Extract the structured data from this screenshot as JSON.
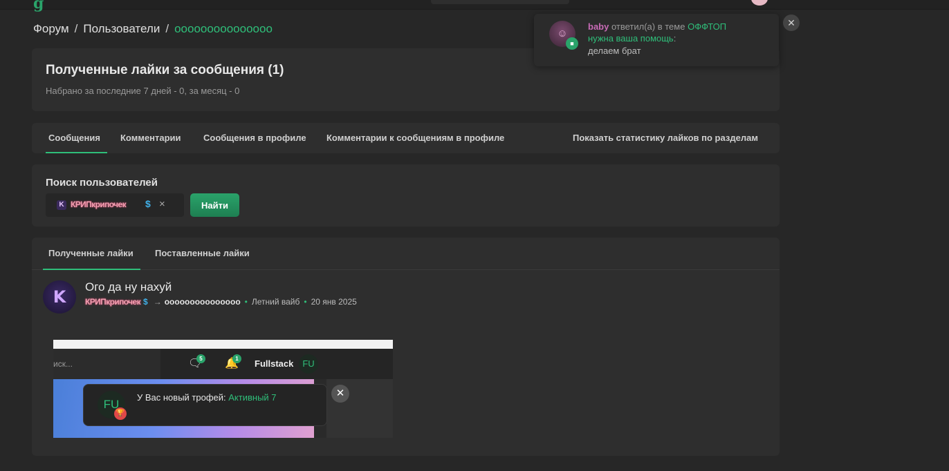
{
  "breadcrumb": {
    "item1": "Форум",
    "sep1": "/",
    "item2": "Пользователи",
    "sep2": "/",
    "current": "ооооооооооооооо"
  },
  "header": {
    "title": "Полученные лайки за сообщения (1)",
    "subtitle": "Набрано за последние 7 дней - 0, за месяц - 0"
  },
  "tabs": {
    "items": [
      "Сообщения",
      "Комментарии",
      "Сообщения в профиле",
      "Комментарии к сообщениям в профиле"
    ],
    "active": 0,
    "stats_link": "Показать статистику лайков по разделам"
  },
  "search": {
    "label": "Поиск пользователей",
    "token_avatar": "K",
    "token_name": "КРИПкрипочек",
    "token_badge": "$",
    "remove": "×",
    "button": "Найти"
  },
  "likes": {
    "tabs": [
      "Полученные лайки",
      "Поставленные лайки"
    ],
    "active": 0,
    "post": {
      "avatar_letter": "K",
      "title": "Ого да ну нахуй",
      "author": "КРИПкрипочек",
      "author_badge": "$",
      "arrow": "→",
      "target": "ооооооооооооооо",
      "section": "Летний вайб",
      "date": "20 янв 2025",
      "dot": "•"
    },
    "screenshot": {
      "search_placeholder": "иск...",
      "messages_count": "5",
      "alerts_count": "1",
      "username": "Fullstack",
      "avatar": "FU"
    }
  },
  "toast": {
    "avatar": "FU",
    "text": "У Вас новый трофей:",
    "link": "Активный 7",
    "close": "✕"
  },
  "notification": {
    "user": "baby",
    "action": "ответил(а) в теме",
    "thread": "ОФФТОП",
    "post_title": "нужна ваша помощь",
    "colon": ":",
    "message": "делаем брат",
    "close": "✕"
  },
  "colors": {
    "accent": "#2fbf7a",
    "background": "#272727",
    "block": "#2e2e2e"
  }
}
